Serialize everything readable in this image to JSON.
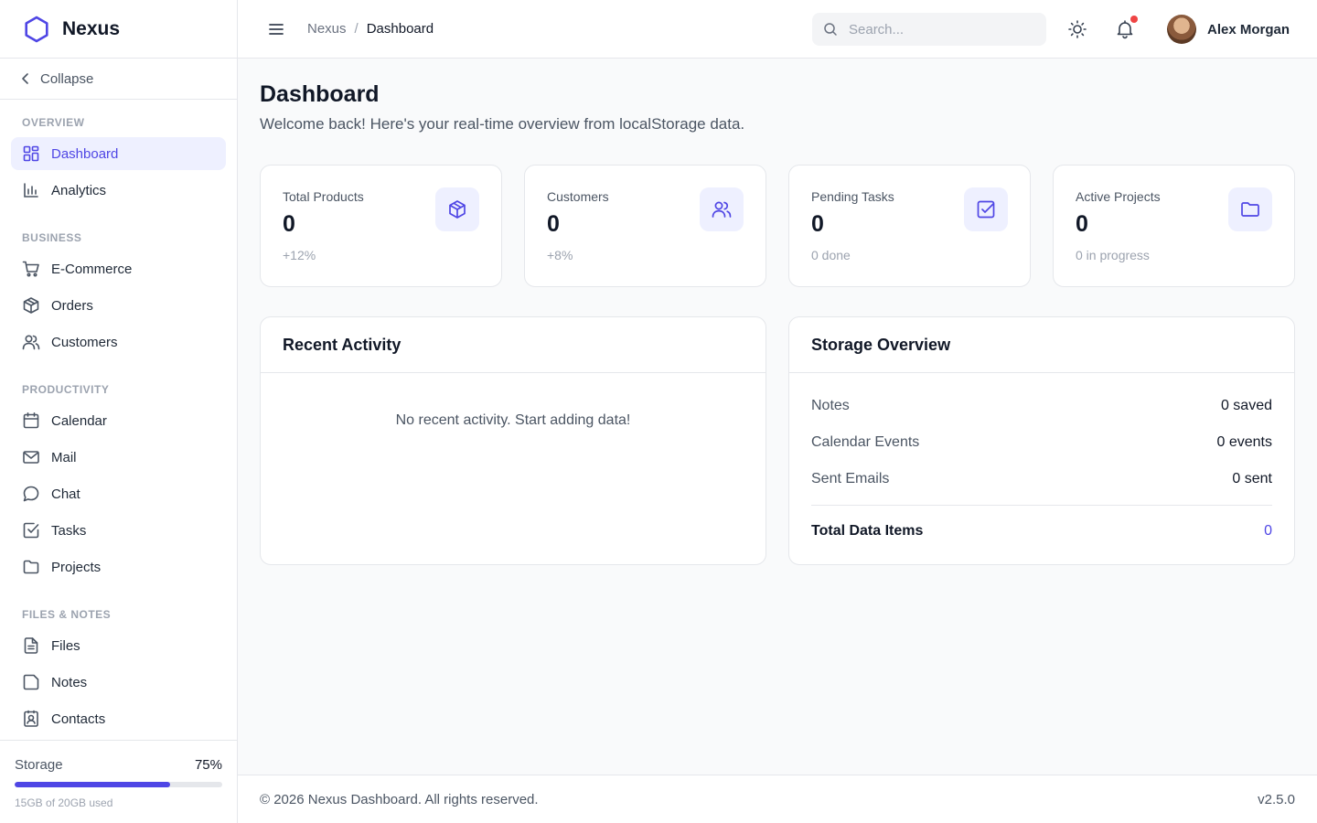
{
  "app": {
    "name": "Nexus",
    "accent": "#4f46e5",
    "logo_icon": "hexagon-logo-icon"
  },
  "sidebar": {
    "collapse_label": "Collapse",
    "sections": [
      {
        "title": "OVERVIEW",
        "items": [
          {
            "label": "Dashboard",
            "icon": "dashboard-grid-icon",
            "active": true
          },
          {
            "label": "Analytics",
            "icon": "bar-chart-icon"
          }
        ]
      },
      {
        "title": "BUSINESS",
        "items": [
          {
            "label": "E-Commerce",
            "icon": "shopping-cart-icon"
          },
          {
            "label": "Orders",
            "icon": "package-icon"
          },
          {
            "label": "Customers",
            "icon": "users-icon"
          }
        ]
      },
      {
        "title": "PRODUCTIVITY",
        "items": [
          {
            "label": "Calendar",
            "icon": "calendar-icon"
          },
          {
            "label": "Mail",
            "icon": "mail-icon"
          },
          {
            "label": "Chat",
            "icon": "chat-bubble-icon"
          },
          {
            "label": "Tasks",
            "icon": "check-square-icon"
          },
          {
            "label": "Projects",
            "icon": "folder-icon"
          }
        ]
      },
      {
        "title": "FILES & NOTES",
        "items": [
          {
            "label": "Files",
            "icon": "file-text-icon"
          },
          {
            "label": "Notes",
            "icon": "sticky-note-icon"
          },
          {
            "label": "Contacts",
            "icon": "contact-card-icon"
          }
        ]
      }
    ],
    "storage": {
      "label": "Storage",
      "percent_label": "75%",
      "percent": 75,
      "used_text": "15GB of 20GB used"
    }
  },
  "topbar": {
    "breadcrumb": {
      "root": "Nexus",
      "separator": "/",
      "current": "Dashboard"
    },
    "search_placeholder": "Search...",
    "user_name": "Alex Morgan"
  },
  "main": {
    "title": "Dashboard",
    "subtitle": "Welcome back! Here's your real-time overview from localStorage data.",
    "stats": [
      {
        "label": "Total Products",
        "value": "0",
        "note": "+12%",
        "icon": "box-icon"
      },
      {
        "label": "Customers",
        "value": "0",
        "note": "+8%",
        "icon": "users-icon"
      },
      {
        "label": "Pending Tasks",
        "value": "0",
        "note": "0 done",
        "icon": "check-square-icon"
      },
      {
        "label": "Active Projects",
        "value": "0",
        "note": "0 in progress",
        "icon": "folder-icon"
      }
    ],
    "recent_activity": {
      "title": "Recent Activity",
      "empty_text": "No recent activity. Start adding data!"
    },
    "storage_overview": {
      "title": "Storage Overview",
      "rows": [
        {
          "label": "Notes",
          "value": "0 saved"
        },
        {
          "label": "Calendar Events",
          "value": "0 events"
        },
        {
          "label": "Sent Emails",
          "value": "0 sent"
        }
      ],
      "total": {
        "label": "Total Data Items",
        "value": "0"
      }
    }
  },
  "footer": {
    "copyright": "© 2026 Nexus Dashboard. All rights reserved.",
    "version": "v2.5.0"
  }
}
